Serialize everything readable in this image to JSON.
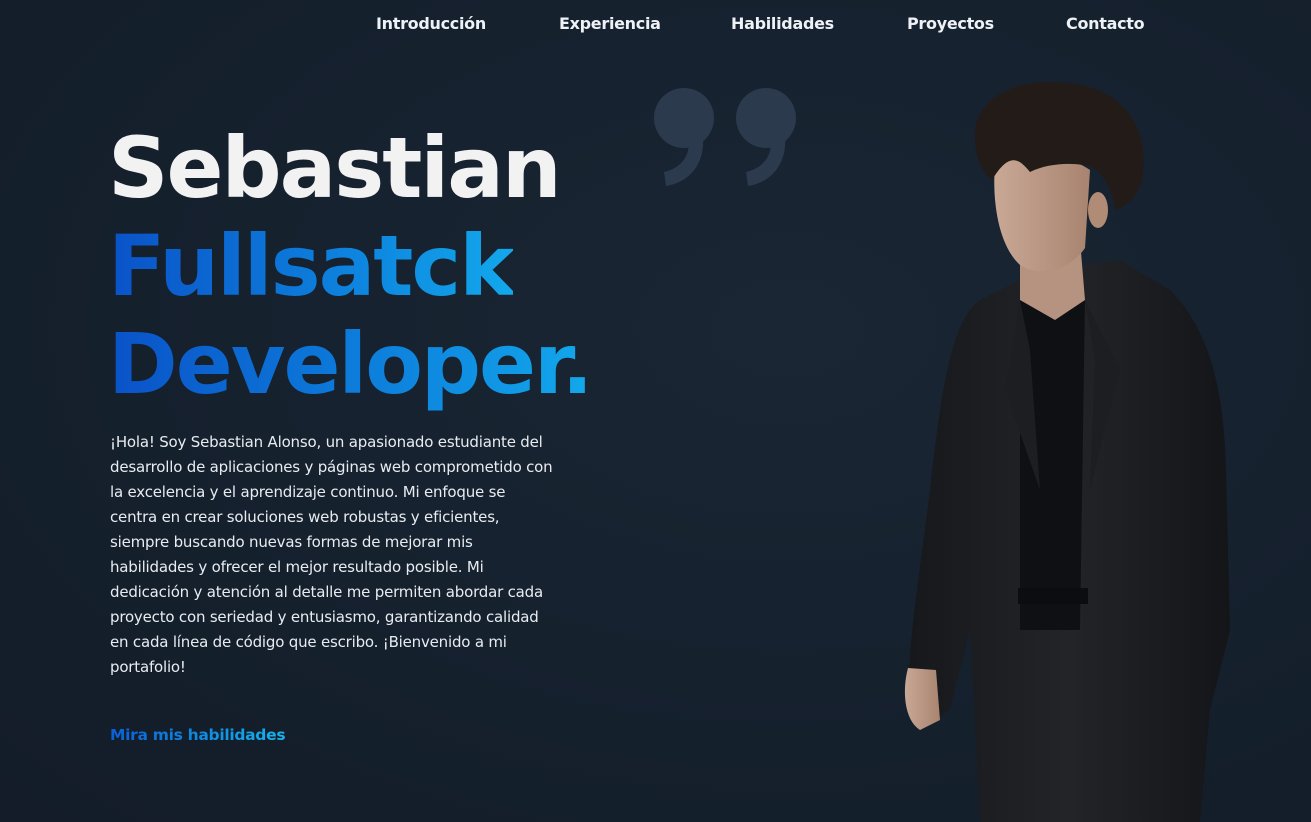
{
  "nav": {
    "items": [
      {
        "label": "Introducción"
      },
      {
        "label": "Experiencia"
      },
      {
        "label": "Habilidades"
      },
      {
        "label": "Proyectos"
      },
      {
        "label": "Contacto"
      }
    ]
  },
  "hero": {
    "name": "Sebastian",
    "role_line_1": "Fullsatck",
    "role_line_2": "Developer.",
    "intro": "¡Hola! Soy Sebastian Alonso, un apasionado estudiante del desarrollo de aplicaciones y páginas web comprometido con la excelencia y el aprendizaje continuo. Mi enfoque se centra en crear soluciones web robustas y eficientes, siempre buscando nuevas formas de mejorar mis habilidades y ofrecer el mejor resultado posible. Mi dedicación y atención al detalle me permiten abordar cada proyecto con seriedad y entusiasmo, garantizando calidad en cada línea de código que escribo. ¡Bienvenido a mi portafolio!",
    "cta": "Mira mis habilidades"
  },
  "icons": {
    "quote": "quote-icon",
    "portrait": "portrait-photo"
  },
  "colors": {
    "background": "#15202d",
    "accent_start": "#0a52c8",
    "accent_end": "#12a8ec",
    "quote": "#2b3a4d",
    "text": "#e8ecf1"
  }
}
